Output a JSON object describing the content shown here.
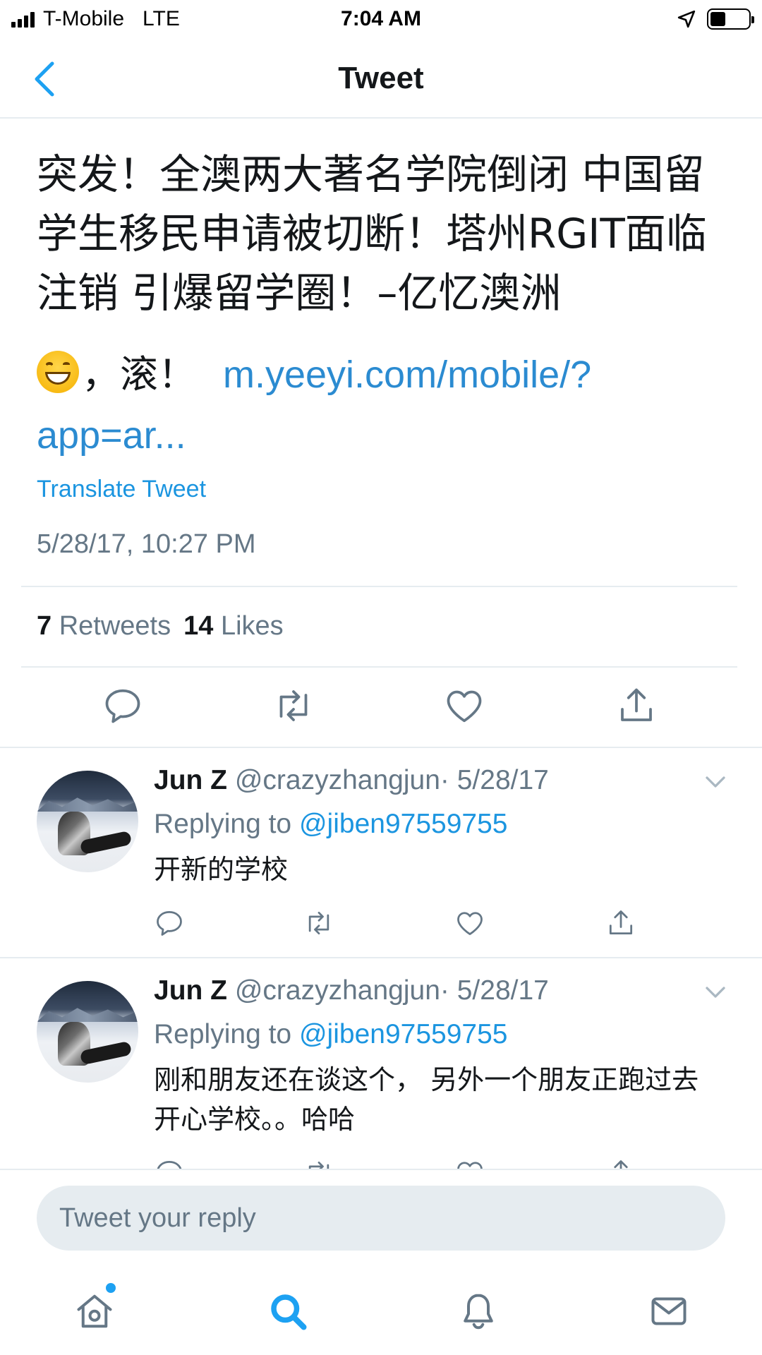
{
  "status_bar": {
    "carrier": "T-Mobile",
    "network": "LTE",
    "time": "7:04 AM"
  },
  "nav": {
    "title": "Tweet"
  },
  "tweet": {
    "text": "突发！全澳两大著名学院倒闭 中国留学生移民申请被切断！塔州RGIT面临注销 引爆留学圈！–亿忆澳洲",
    "comment": "，滚！",
    "link": "m.yeeyi.com/mobile/?app=ar...",
    "translate_label": "Translate Tweet",
    "timestamp": "5/28/17, 10:27 PM",
    "retweets_count": "7",
    "retweets_label": "Retweets",
    "likes_count": "14",
    "likes_label": "Likes"
  },
  "replies": [
    {
      "name": "Jun Z",
      "handle": "@crazyzhangjun",
      "date": "· 5/28/17",
      "replying_label": "Replying to",
      "replying_to": "@jiben97559755",
      "text": "开新的学校"
    },
    {
      "name": "Jun Z",
      "handle": "@crazyzhangjun",
      "date": "· 5/28/17",
      "replying_label": "Replying to",
      "replying_to": "@jiben97559755",
      "text": "刚和朋友还在谈这个， 另外一个朋友正跑过去开心学校。。哈哈"
    }
  ],
  "compose": {
    "placeholder": "Tweet your reply"
  },
  "colors": {
    "accent": "#1da1f2",
    "link": "#1b95e0",
    "secondary_text": "#657786",
    "divider": "#e6ecf0"
  },
  "icons": {
    "tabbar": [
      "home-icon",
      "search-icon",
      "notifications-icon",
      "messages-icon"
    ],
    "actions": [
      "reply-icon",
      "retweet-icon",
      "like-icon",
      "share-icon"
    ]
  }
}
